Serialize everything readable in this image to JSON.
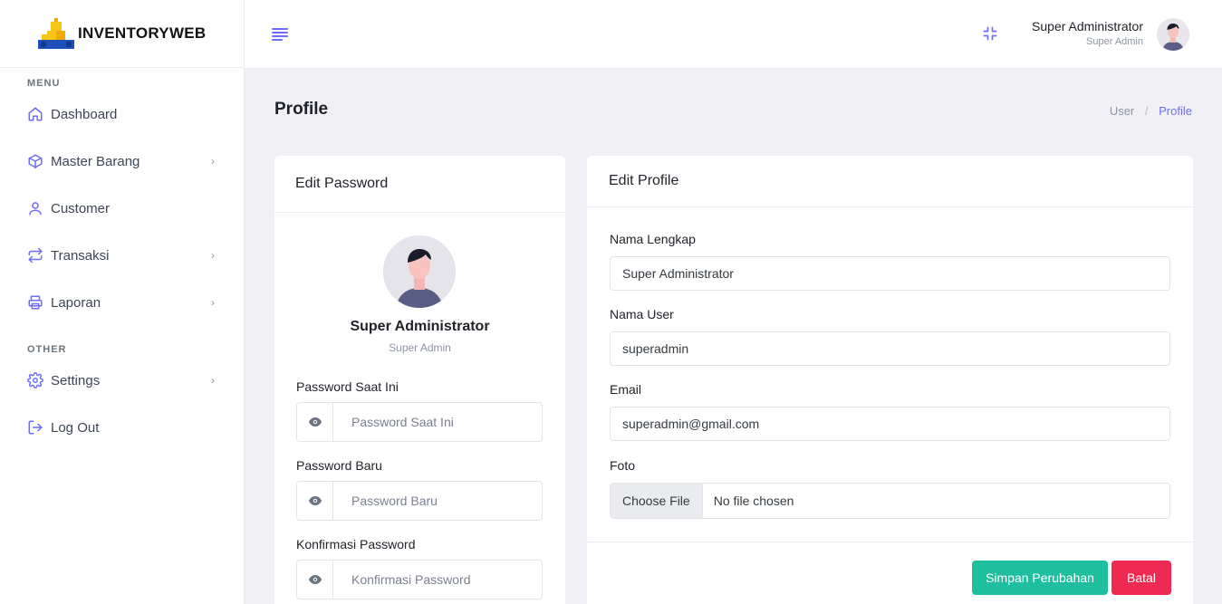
{
  "brand": {
    "name": "INVENTORYWEB"
  },
  "sidebar": {
    "menu_title": "MENU",
    "items": [
      {
        "label": "Dashboard",
        "icon": "home-icon",
        "has_children": false
      },
      {
        "label": "Master Barang",
        "icon": "box-icon",
        "has_children": true
      },
      {
        "label": "Customer",
        "icon": "user-icon",
        "has_children": false
      },
      {
        "label": "Transaksi",
        "icon": "repeat-icon",
        "has_children": true
      },
      {
        "label": "Laporan",
        "icon": "printer-icon",
        "has_children": true
      }
    ],
    "other_title": "OTHER",
    "other_items": [
      {
        "label": "Settings",
        "icon": "gear-icon",
        "has_children": true
      },
      {
        "label": "Log Out",
        "icon": "logout-icon",
        "has_children": false
      }
    ]
  },
  "header": {
    "user_name": "Super Administrator",
    "user_role": "Super Admin"
  },
  "page": {
    "title": "Profile",
    "breadcrumb": [
      "User",
      "Profile"
    ]
  },
  "edit_password": {
    "title": "Edit Password",
    "name": "Super Administrator",
    "role": "Super Admin",
    "current_label": "Password Saat Ini",
    "current_placeholder": "Password Saat Ini",
    "new_label": "Password Baru",
    "new_placeholder": "Password Baru",
    "confirm_label": "Konfirmasi Password",
    "confirm_placeholder": "Konfirmasi Password"
  },
  "edit_profile": {
    "title": "Edit Profile",
    "fullname_label": "Nama Lengkap",
    "fullname_value": "Super Administrator",
    "username_label": "Nama User",
    "username_value": "superadmin",
    "email_label": "Email",
    "email_value": "superadmin@gmail.com",
    "photo_label": "Foto",
    "file_button": "Choose File",
    "file_status": "No file chosen",
    "save_button": "Simpan Perubahan",
    "cancel_button": "Batal"
  },
  "colors": {
    "accent": "#6c6ff5",
    "save": "#1fbe9f",
    "cancel": "#ee2a52",
    "background": "#f0f0f5"
  }
}
